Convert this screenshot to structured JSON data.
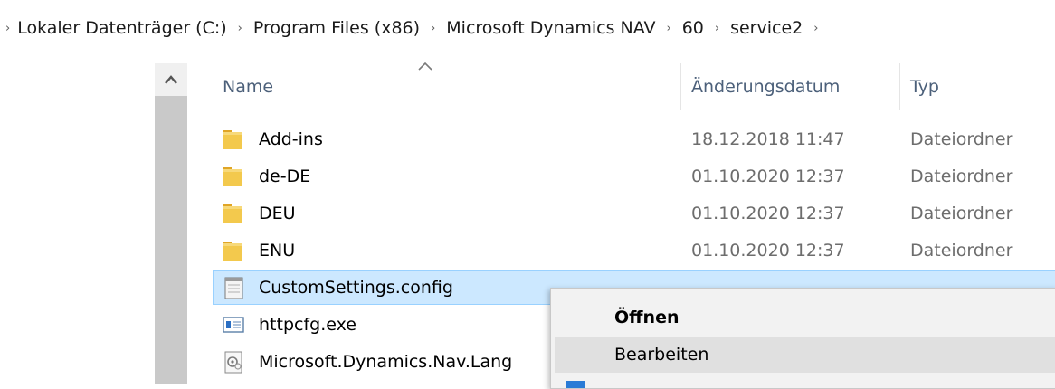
{
  "breadcrumb": {
    "segments": [
      "Lokaler Datenträger (C:)",
      "Program Files (x86)",
      "Microsoft Dynamics NAV",
      "60",
      "service2"
    ]
  },
  "columns": {
    "name": "Name",
    "date": "Änderungsdatum",
    "type": "Typ"
  },
  "files": [
    {
      "name": "Add-ins",
      "date": "18.12.2018 11:47",
      "type": "Dateiordner",
      "icon": "folder-icon"
    },
    {
      "name": "de-DE",
      "date": "01.10.2020 12:37",
      "type": "Dateiordner",
      "icon": "folder-icon"
    },
    {
      "name": "DEU",
      "date": "01.10.2020 12:37",
      "type": "Dateiordner",
      "icon": "folder-icon"
    },
    {
      "name": "ENU",
      "date": "01.10.2020 12:37",
      "type": "Dateiordner",
      "icon": "folder-icon"
    },
    {
      "name": "CustomSettings.config",
      "date": "",
      "type": "",
      "icon": "config-file-icon",
      "selected": true
    },
    {
      "name": "httpcfg.exe",
      "date": "",
      "type": "",
      "icon": "exe-file-icon"
    },
    {
      "name": "Microsoft.Dynamics.Nav.Lang",
      "date": "",
      "type": "",
      "icon": "dll-file-icon"
    }
  ],
  "context_menu": {
    "open": "Öffnen",
    "edit": "Bearbeiten"
  },
  "colors": {
    "selection": "#cce8ff",
    "folder": "#f3c94d",
    "header_text": "#4c607a"
  }
}
